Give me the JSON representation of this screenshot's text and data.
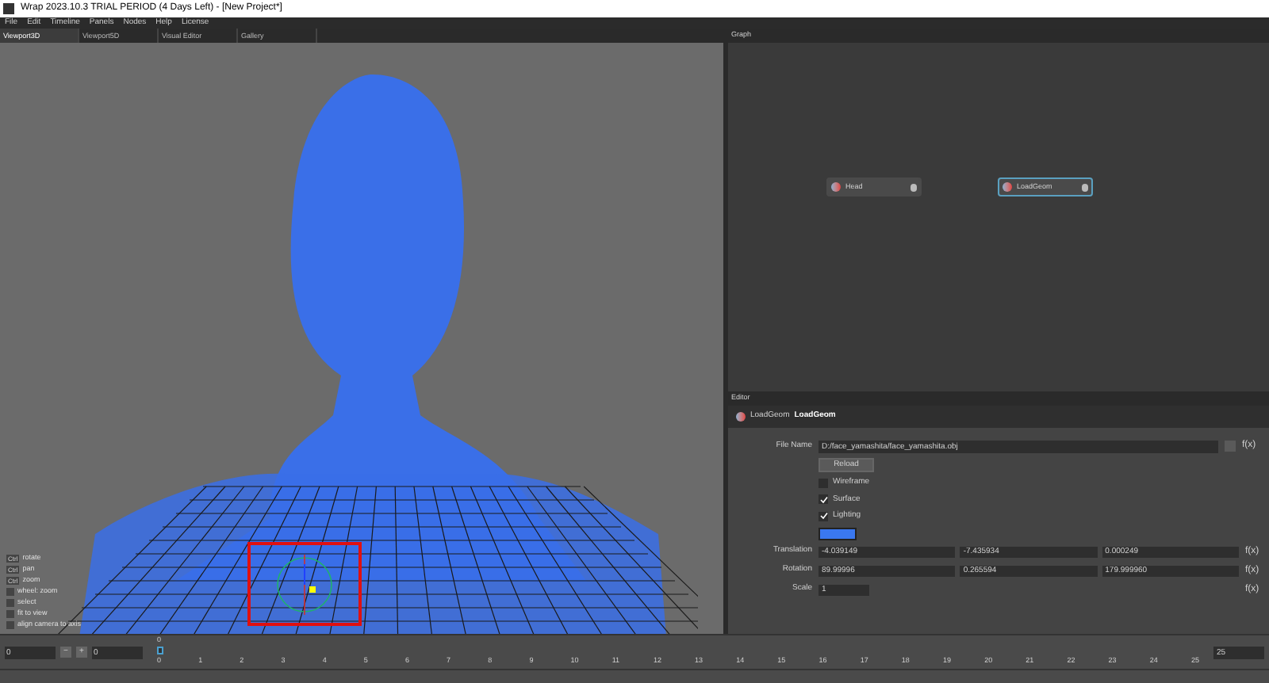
{
  "window": {
    "title": "Wrap 2023.10.3  TRIAL PERIOD (4 Days Left) - [New Project*]"
  },
  "menu": [
    "File",
    "Edit",
    "Timeline",
    "Panels",
    "Nodes",
    "Help",
    "License"
  ],
  "tabs": [
    {
      "label": "Viewport3D",
      "selected": true
    },
    {
      "label": "Viewport5D",
      "selected": false
    },
    {
      "label": "Visual Editor",
      "selected": false
    },
    {
      "label": "Gallery",
      "selected": false
    }
  ],
  "viewport": {
    "hints": [
      {
        "key": "Ctrl",
        "text": "rotate"
      },
      {
        "key": "Ctrl",
        "text": "pan"
      },
      {
        "key": "Ctrl",
        "text": "zoom"
      },
      {
        "text": "wheel: zoom"
      },
      {
        "text": "select"
      },
      {
        "text": "fit to view"
      },
      {
        "text": "align camera to axis"
      }
    ]
  },
  "graph": {
    "title": "Graph",
    "nodes": [
      {
        "label": "Head",
        "selected": false
      },
      {
        "label": "LoadGeom",
        "selected": true
      }
    ]
  },
  "editor": {
    "title": "Editor",
    "node_type": "LoadGeom",
    "node_name": "LoadGeom",
    "file_name_label": "File Name",
    "file_name": "D:/face_yamashita/face_yamashita.obj",
    "fx": "f(x)",
    "reload": "Reload",
    "checks": [
      {
        "label": "Wireframe",
        "checked": false
      },
      {
        "label": "Surface",
        "checked": true
      },
      {
        "label": "Lighting",
        "checked": true
      }
    ],
    "color": "#3a78f0",
    "vectors": [
      {
        "label": "Translation",
        "values": [
          "-4.039149",
          "-7.435934",
          "0.000249"
        ],
        "fx": "f(x)"
      },
      {
        "label": "Rotation",
        "values": [
          "89.99996",
          "0.265594",
          "179.999960"
        ],
        "fx": "f(x)"
      },
      {
        "label": "Scale",
        "values": [
          "1"
        ],
        "fx": "f(x)"
      }
    ]
  },
  "timeline": {
    "start": "0",
    "minus": "−",
    "plus": "+",
    "current": "0",
    "marker": "0",
    "ticks": [
      "0",
      "1",
      "2",
      "3",
      "4",
      "5",
      "6",
      "7",
      "8",
      "9",
      "10",
      "11",
      "12",
      "13",
      "14",
      "15",
      "16",
      "17",
      "18",
      "19",
      "20",
      "21",
      "22",
      "23",
      "24",
      "25"
    ],
    "end": "25"
  }
}
